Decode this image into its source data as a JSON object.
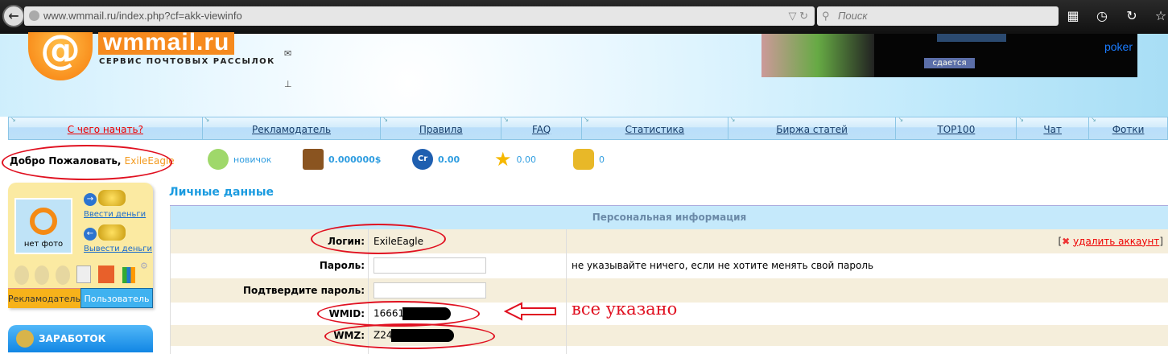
{
  "browser": {
    "url": "www.wmmail.ru/index.php?cf=akk-viewinfo",
    "search_placeholder": "Поиск"
  },
  "header": {
    "logo_text": "wmmail.ru",
    "logo_subtitle": "СЕРВИС ПОЧТОВЫХ РАССЫЛОК",
    "ad_brand": "poker",
    "ad_label": "сдается"
  },
  "nav": [
    {
      "label": "С чего начать?"
    },
    {
      "label": "Рекламодатель"
    },
    {
      "label": "Правила"
    },
    {
      "label": "FAQ"
    },
    {
      "label": "Статистика"
    },
    {
      "label": "Биржа статей"
    },
    {
      "label": "TOP100"
    },
    {
      "label": "Чат"
    },
    {
      "label": "Фотки"
    }
  ],
  "welcome": {
    "greeting": "Добро Пожаловать,",
    "username": "ExileEagle"
  },
  "stats": {
    "rank": "новичок",
    "balance": "0.000000$",
    "credits": "0.00",
    "rating": "0.00",
    "coins": "0"
  },
  "sidebar": {
    "no_photo": "нет фото",
    "deposit": "Ввести деньги",
    "withdraw": "Вывести деньги",
    "tab_advertiser": "Рекламодатель",
    "tab_user": "Пользователь",
    "earn": "ЗАРАБОТОК"
  },
  "main": {
    "title": "Личные данные",
    "table_header": "Персональная информация",
    "rows": {
      "login_label": "Логин:",
      "login_value": "ExileEagle",
      "delete_account": "удалить аккаунт",
      "password_label": "Пароль:",
      "password_hint": "не указывайте ничего, если не хотите менять свой пароль",
      "confirm_label": "Подтвердите пароль:",
      "wmid_label": "WMID:",
      "wmid_value": "16661",
      "wmz_label": "WMZ:",
      "wmz_value": "Z24"
    }
  },
  "annotation": {
    "text": "все указано",
    "color": "#e01020"
  }
}
